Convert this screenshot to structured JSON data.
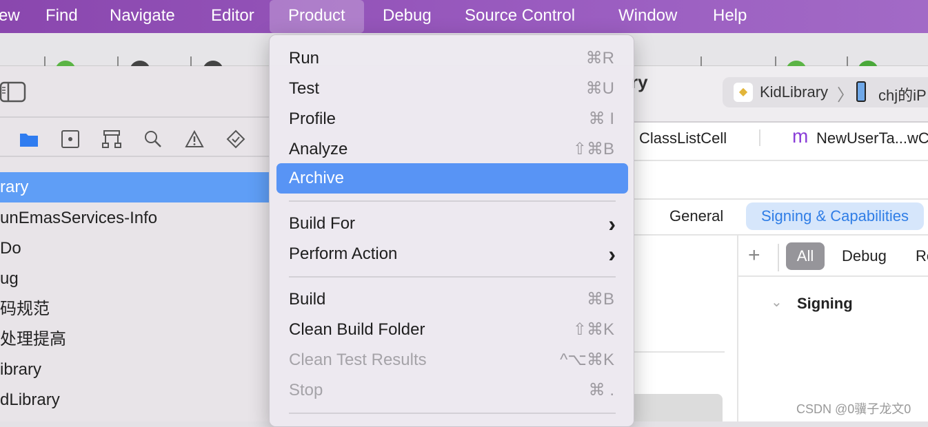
{
  "menubar": {
    "items": [
      "ew",
      "Find",
      "Navigate",
      "Editor",
      "Product",
      "Debug",
      "Source Control",
      "Window",
      "Help"
    ],
    "active": "Product"
  },
  "navigator": {
    "items": [
      "rary",
      "unEmasServices-Info",
      "Do",
      "ug",
      "码规范",
      "处理提高",
      "ibrary",
      "dLibrary"
    ],
    "selected_index": 0,
    "accent": "#5f9ef6"
  },
  "product_menu": {
    "items": [
      {
        "label": "Run",
        "shortcut": "⌘R"
      },
      {
        "label": "Test",
        "shortcut": "⌘U"
      },
      {
        "label": "Profile",
        "shortcut": "⌘ I"
      },
      {
        "label": "Analyze",
        "shortcut": "⇧⌘B"
      },
      {
        "label": "Archive",
        "shortcut": "",
        "highlighted": true
      },
      {
        "label": "Build For",
        "submenu": true
      },
      {
        "label": "Perform Action",
        "submenu": true
      },
      {
        "label": "Build",
        "shortcut": "⌘B"
      },
      {
        "label": "Clean Build Folder",
        "shortcut": "⇧⌘K"
      },
      {
        "label": "Clean Test Results",
        "shortcut": "^⌥⌘K",
        "disabled": true
      },
      {
        "label": "Stop",
        "shortcut": "⌘ .",
        "disabled": true
      }
    ]
  },
  "editor": {
    "title_fragment": "ry",
    "scheme": "KidLibrary",
    "device": "chj的iP",
    "tabs": [
      "ClassListCell",
      "NewUserTa...wC"
    ],
    "tab_icon_letter": "m",
    "segments": [
      "General",
      "Signing & Capabilities"
    ],
    "active_segment": "Signing & Capabilities",
    "filters": [
      "All",
      "Debug",
      "Re"
    ],
    "section": "Signing"
  },
  "watermark": "CSDN @0骥子龙文0"
}
